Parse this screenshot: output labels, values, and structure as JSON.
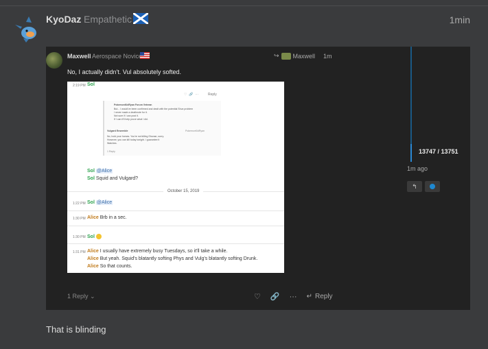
{
  "post": {
    "username": "KyoDaz",
    "user_title": "Empathetic",
    "time": "1min",
    "body": "That is blinding"
  },
  "quote": {
    "username": "Maxwell",
    "user_title": "Aerospace Novice",
    "reply_to": "Maxwell",
    "time": "1m",
    "text": "No, I actually didn't. Vul absolutely softed.",
    "replies_label": "1 Reply",
    "reply_button": "Reply",
    "timeline": {
      "count": "13747 / 13751",
      "ago": "1m ago"
    }
  },
  "screenshot": {
    "top_time": "2:19 PM",
    "top_name": "Sol",
    "nested_lines": [
      "PokemonKidRyan Forum Veteran",
      "But... I would've been confirmed and dealt with the potential Shun problem",
      "I never made a deathnote for it.",
      "Not sure if I can post it.",
      "If I can it'll help prove what I did.",
      "Vulgard Ensemble",
      "PokemonKidRyan",
      "No, hold your horses. You're not killing Shunan, sorry.",
      "However, you can kill today tonight. I guarantee it",
      "Watches."
    ],
    "nested_reply": "1 Reply",
    "sol_line1": "@Alice",
    "sol_line2": "Squid and Vulgard?",
    "date_sep": "October 15, 2019",
    "msg1_time": "1:22 PM",
    "msg1_mention": "@Alice",
    "msg2_time": "1:30 PM",
    "msg2_text": "Brb in a sec.",
    "msg3_time": "1:30 PM",
    "msg4_time": "1:31 PM",
    "msg4_lines": [
      "I usually have extremely busy Tuesdays, so it'll take a while.",
      "But yeah. Squid's blatantly softing Phys and Vulg's blatantly softing Drunk.",
      "So that counts."
    ],
    "names": {
      "sol": "Sol",
      "alice": "Alice"
    },
    "reply_label": "Reply"
  }
}
